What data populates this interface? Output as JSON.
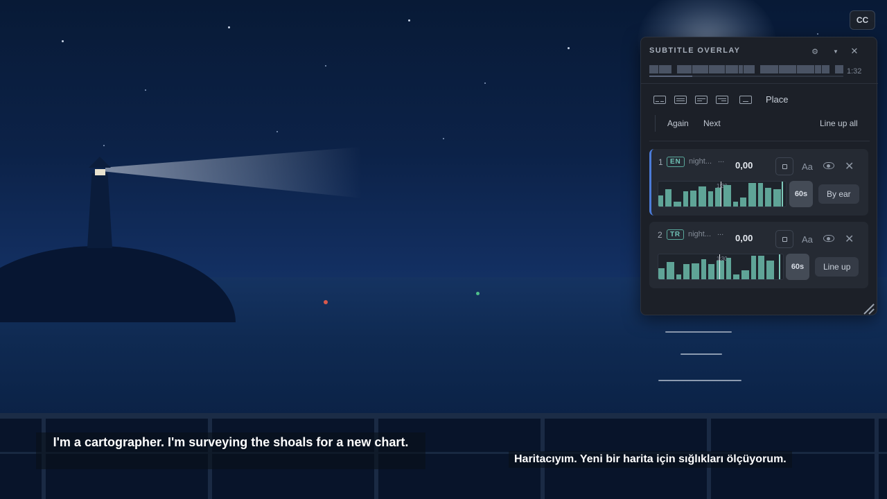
{
  "cc_button": {
    "label": "CC"
  },
  "overlay": {
    "title": "SUBTITLE OVERLAY",
    "icons": {
      "settings": "gear-icon",
      "collapse": "chevron-down-icon",
      "close": "close-icon"
    },
    "timeline": {
      "duration": "1:32",
      "progress_fraction": 0.22
    },
    "position_buttons": [
      "bottom-split",
      "center",
      "left-align",
      "right-align",
      "bottom"
    ],
    "place_label": "Place",
    "again_label": "Again",
    "next_label": "Next",
    "line_up_all_label": "Line up all",
    "tracks": [
      {
        "index": "1",
        "lang": "EN",
        "name": "night...",
        "more": "...",
        "offset": "0,00",
        "font_label": "Aa",
        "wave_time": "1:30",
        "window_label": "60s",
        "action_label": "By ear",
        "active": true
      },
      {
        "index": "2",
        "lang": "TR",
        "name": "night...",
        "more": "...",
        "offset": "0,00",
        "font_label": "Aa",
        "wave_time": "1:30",
        "window_label": "60s",
        "action_label": "Line up",
        "active": false
      }
    ]
  },
  "subtitles": {
    "english": "I'm a cartographer. I'm surveying the shoals for a new chart.",
    "turkish": "Haritacıyım. Yeni bir harita için sığlıkları ölçüyorum."
  },
  "colors": {
    "accent": "#4b7bd8",
    "waveform": "#5fa497",
    "lang_badge": "#6fc3b6",
    "buoy_red": "#d9594c",
    "buoy_green": "#4fbf8a"
  }
}
